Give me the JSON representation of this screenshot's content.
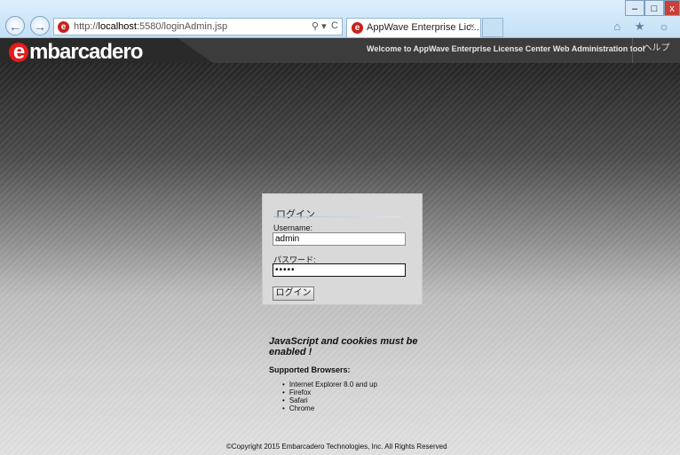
{
  "browser": {
    "url_prefix": "http://",
    "url_host": "localhost",
    "url_path": ":5580/loginAdmin.jsp",
    "tab_title": "AppWave Enterprise Lic...",
    "search_glyph": "⚲ ▾",
    "refresh_glyph": "C",
    "close_tab_glyph": "×",
    "back_glyph": "←",
    "forward_glyph": "→",
    "toolbar_icons": "⌂ ★ ☼",
    "min_glyph": "–",
    "max_glyph": "□",
    "close_glyph": "x"
  },
  "header": {
    "logo_e": "e",
    "logo_rest": "mbarcadero",
    "welcome": "Welcome to AppWave Enterprise License Center Web Administration tool",
    "help": "ヘルプ"
  },
  "login": {
    "title": "ログイン",
    "username_label": "Username:",
    "username_value": "admin",
    "password_label": "パスワード:",
    "password_value": "•••••",
    "button": "ログイン"
  },
  "notice": {
    "requirement": "JavaScript and cookies must be enabled !",
    "browsers_title": "Supported Browsers:",
    "browsers": [
      "Internet Explorer 8.0 and up",
      "Firefox",
      "Safari",
      "Chrome"
    ]
  },
  "footer": {
    "copyright": "©Copyright 2015 Embarcadero Technologies, Inc. All Rights Reserved"
  },
  "colors": {
    "brand_red": "#e31d1a",
    "ie_blue": "#c4e0f6"
  }
}
